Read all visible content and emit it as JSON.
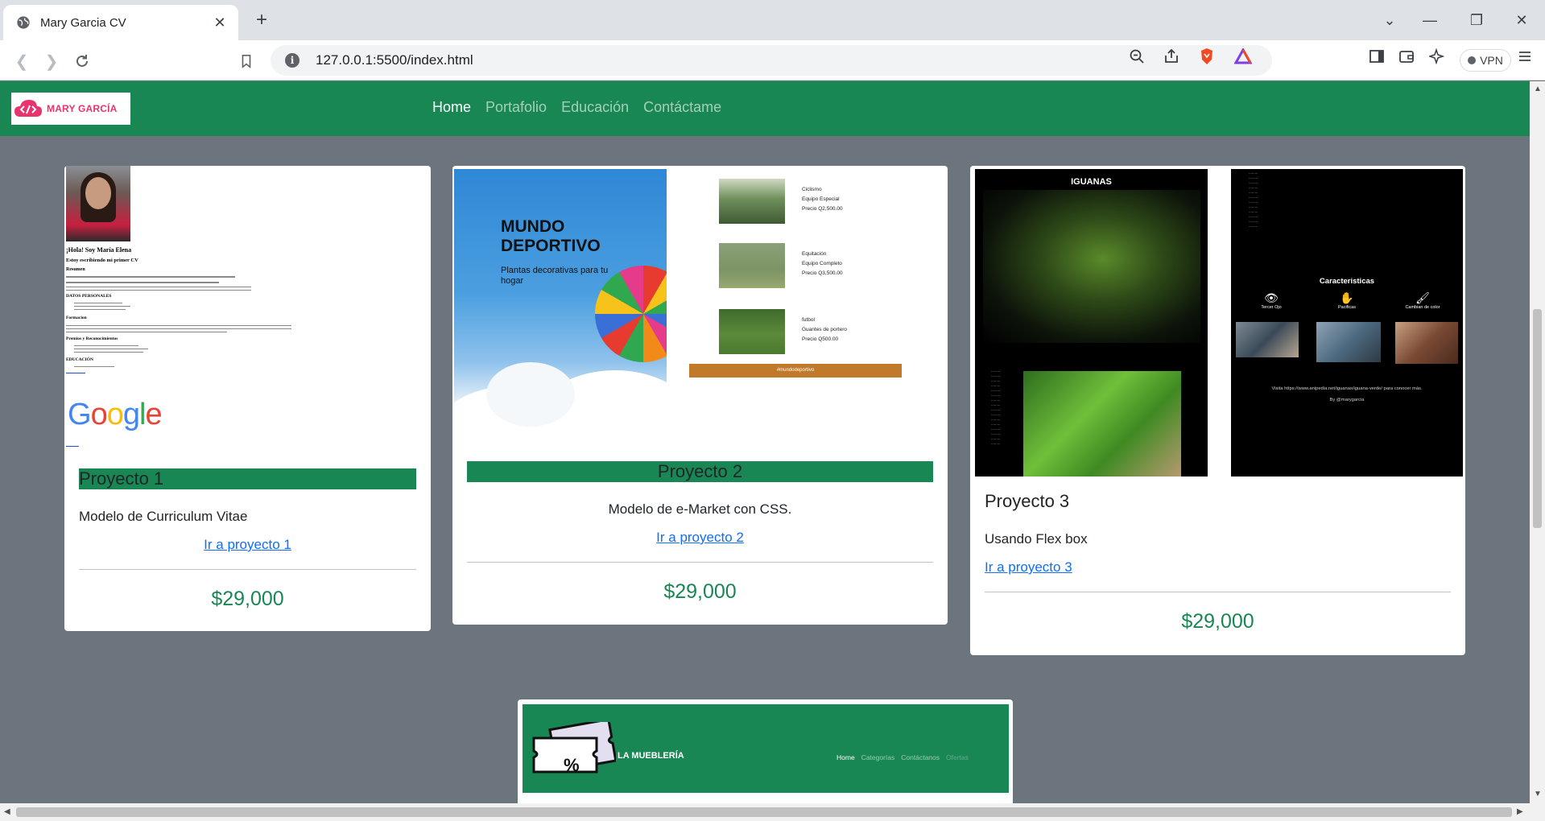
{
  "browser": {
    "tab_title": "Mary Garcia CV",
    "url": "127.0.0.1:5500/index.html",
    "vpn_label": "VPN"
  },
  "site": {
    "brand_name": "MARY GARCÍA",
    "nav": [
      "Home",
      "Portafolio",
      "Educación",
      "Contáctame"
    ],
    "accent_color": "#198754",
    "background_color": "#6c757d"
  },
  "projects": [
    {
      "title": "Proyecto 1",
      "description": "Modelo de Curriculum Vitae",
      "link": "Ir a proyecto 1",
      "price": "$29,000",
      "preview": {
        "heading": "¡Hola! Soy María Elena",
        "subheading": "Estoy escribiendo mi primer CV",
        "sections": [
          "Resumen",
          "DATOS PERSONALES",
          "Formacion",
          "Premios y Reconocimientos",
          "EDUCACIÓN"
        ],
        "logo": "Google"
      }
    },
    {
      "title": "Proyecto 2",
      "description": "Modelo de e-Market con CSS.",
      "link": "Ir a proyecto 2",
      "price": "$29,000",
      "preview": {
        "title_line1": "MUNDO",
        "title_line2": "DEPORTIVO",
        "subtitle": "Plantas decorativas para tu hogar",
        "items": [
          {
            "name": "Ciclismo",
            "detail": "Equipo Especial",
            "price": "Precio Q2,500.00"
          },
          {
            "name": "Equitación",
            "detail": "Equipo Completo",
            "price": "Precio Q3,500.00"
          },
          {
            "name": "futbol",
            "detail": "Guantes de portero",
            "price": "Precio Q500.00"
          }
        ],
        "tag": "#mundodeportivo"
      }
    },
    {
      "title": "Proyecto 3",
      "description": "Usando Flex box",
      "link": "Ir a proyecto 3",
      "price": "$29,000",
      "preview": {
        "title": "IGUANAS",
        "features_title": "Caracteristicas",
        "features": [
          "Tercer Ojo",
          "Pacificas",
          "Cambian de color"
        ],
        "footer": "Visita https://www.anipedia.net/iguanas/iguana-verde/ para conocer más.",
        "credit": "By @marygarcia"
      }
    },
    {
      "preview": {
        "brand": "LA MUEBLERÍA",
        "coupon_symbol": "%",
        "nav": [
          "Home",
          "Categorías",
          "Contáctanos",
          "Ofertas"
        ]
      }
    }
  ]
}
